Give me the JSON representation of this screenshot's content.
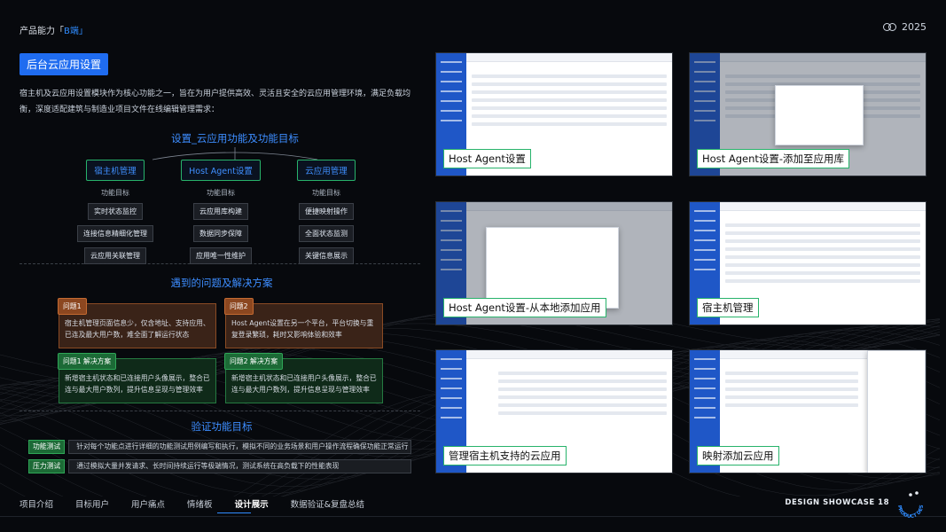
{
  "header": {
    "brand_prefix": "产品能力「",
    "brand_accent": "B端",
    "brand_suffix": "」",
    "year": "2025"
  },
  "section_tag": "后台云应用设置",
  "intro": "宿主机及云应用设置模块作为核心功能之一，旨在为用户提供高效、灵活且安全的云应用管理环境，满足负载均衡，深度适配建筑与制造业项目文件在线编辑管理需求：",
  "tree": {
    "title": "设置_云应用功能及功能目标",
    "columns": [
      {
        "head": "宿主机管理",
        "sub": "功能目标",
        "items": [
          "实时状态监控",
          "连接信息精细化管理",
          "云应用关联管理"
        ]
      },
      {
        "head": "Host Agent设置",
        "sub": "功能目标",
        "items": [
          "云应用库构建",
          "数据同步保障",
          "应用唯一性维护"
        ]
      },
      {
        "head": "云应用管理",
        "sub": "功能目标",
        "items": [
          "便捷映射操作",
          "全面状态监测",
          "关键信息展示"
        ]
      }
    ]
  },
  "problems": {
    "title": "遇到的问题及解决方案",
    "cards": [
      {
        "label": "问题1",
        "text": "宿主机管理页面信息少，仅含地址、支持应用、已连及最大用户数，难全面了解运行状态",
        "kind": "warn"
      },
      {
        "label": "问题2",
        "text": "Host Agent设置在另一个平台，平台切换与重复登录繁琐，耗时又影响体验和效率",
        "kind": "warn"
      },
      {
        "label": "问题1 解决方案",
        "text": "新增宿主机状态和已连接用户头像展示，整合已连与最大用户数列，提升信息呈现与管理效率",
        "kind": "ok"
      },
      {
        "label": "问题2 解决方案",
        "text": "新增宿主机状态和已连接用户头像展示，整合已连与最大用户数列，提升信息呈现与管理效率",
        "kind": "ok"
      }
    ]
  },
  "verify": {
    "title": "验证功能目标",
    "rows": [
      {
        "tag": "功能测试",
        "desc": "针对每个功能点进行详细的功能测试用例编写和执行，模拟不同的业务场景和用户操作流程确保功能正常运行"
      },
      {
        "tag": "压力测试",
        "desc": "通过模拟大量并发请求、长时间持续运行等极端情况，测试系统在高负载下的性能表现"
      }
    ]
  },
  "screenshots": [
    {
      "caption": "Host Agent设置",
      "variant": "list"
    },
    {
      "caption": "Host Agent设置-添加至应用库",
      "variant": "modal"
    },
    {
      "caption": "Host Agent设置-从本地添加应用",
      "variant": "folders"
    },
    {
      "caption": "宿主机管理",
      "variant": "list"
    },
    {
      "caption": "管理宿主机支持的云应用",
      "variant": "tree"
    },
    {
      "caption": "映射添加云应用",
      "variant": "drawer"
    }
  ],
  "nav": {
    "items": [
      "项目介绍",
      "目标用户",
      "用户痛点",
      "情绪板",
      "设计展示",
      "数据验证&复盘总结"
    ],
    "active_index": 4
  },
  "footer": {
    "showcase": "DESIGN SHOWCASE 18",
    "badge_text": "PRODUCT DESIGN"
  },
  "colors": {
    "accent_blue": "#2f8cff",
    "warn_orange": "#8c4720",
    "ok_green": "#1c6a36",
    "node_border_green": "#28b36b"
  }
}
